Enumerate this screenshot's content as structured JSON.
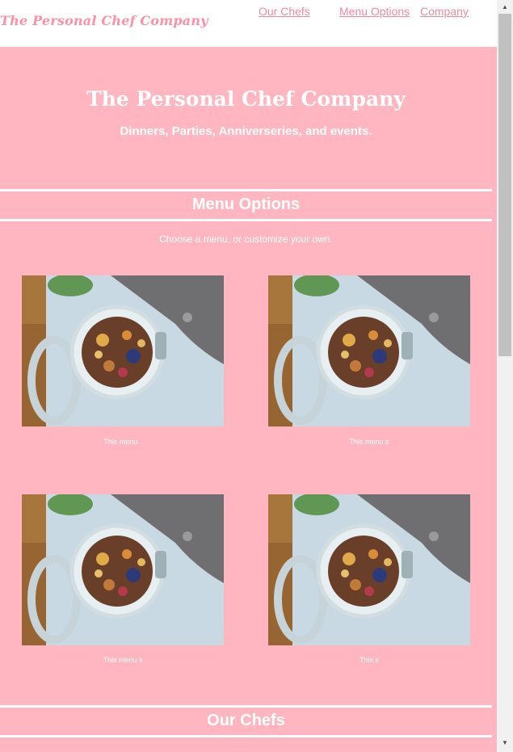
{
  "nav": {
    "logo": "The Personal Chef Company",
    "links": [
      "Our Chefs",
      "Menu Options",
      "Company"
    ]
  },
  "hero": {
    "title": "The Personal Chef Company",
    "subtitle": "Dinners, Parties, Anniverseries, and events."
  },
  "menu_section": {
    "title": "Menu Options",
    "subtitle": "Choose a menu, or customize your own.",
    "cards": [
      {
        "caption": "This menu ."
      },
      {
        "caption": "This menu s"
      },
      {
        "caption": "This menu s"
      },
      {
        "caption": "This s"
      }
    ]
  },
  "chefs_section": {
    "title": "Our Chefs"
  },
  "colors": {
    "page_bg": "#ffb6c1",
    "nav_bg": "#ffffff",
    "link": "#f28a9c",
    "text": "#ffffff"
  },
  "icons": {
    "scroll_up": "scroll-up-arrow-icon",
    "scroll_down": "scroll-down-arrow-icon"
  }
}
